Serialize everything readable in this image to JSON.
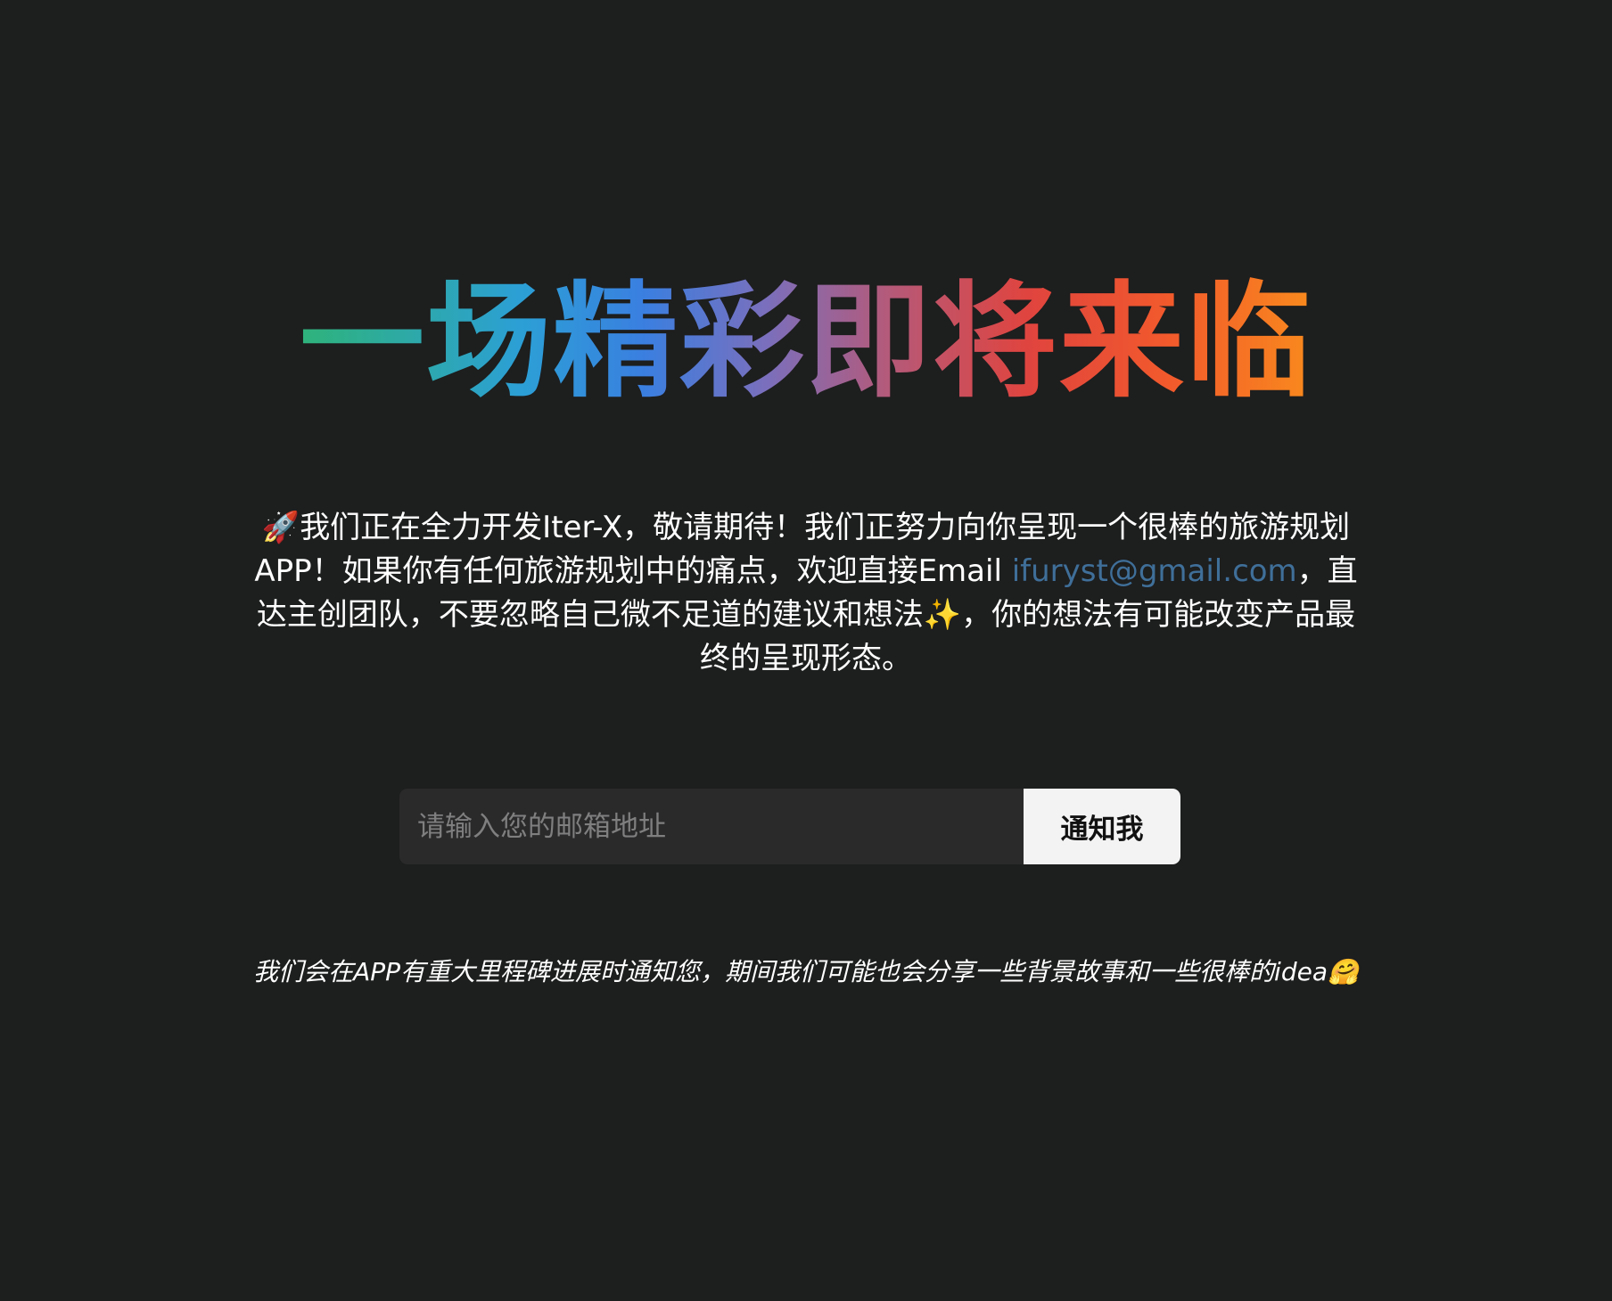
{
  "hero": {
    "title": "一场精彩即将来临"
  },
  "intro": {
    "rocket_emoji": "🚀",
    "text_part1": "我们正在全力开发Iter-X，敬请期待！我们正努力向你呈现一个很棒的旅游规划APP！如果你有任何旅游规划中的痛点，欢迎直接Email ",
    "email": "ifuryst@gmail.com",
    "text_part2": "，直达主创团队，不要忽略自己微不足道的建议和想法",
    "sparkle_emoji": "✨",
    "text_part3": "，你的想法有可能改变产品最终的呈现形态。"
  },
  "signup": {
    "placeholder": "请输入您的邮箱地址",
    "value": "",
    "button_label": "通知我"
  },
  "footer": {
    "note": "我们会在APP有重大里程碑进展时通知您，期间我们可能也会分享一些背景故事和一些很棒的idea",
    "hug_emoji": "🤗"
  },
  "colors": {
    "background": "#1d1e1e",
    "email_link": "#3f6f99",
    "input_background": "#2a2a2b",
    "button_background": "#f3f3f3",
    "title_gradient": [
      "#2fb37a",
      "#2c9fd6",
      "#3a7fe0",
      "#7a6fbd",
      "#b45a7a",
      "#e0443e",
      "#f25a2c",
      "#f98a1d"
    ]
  }
}
